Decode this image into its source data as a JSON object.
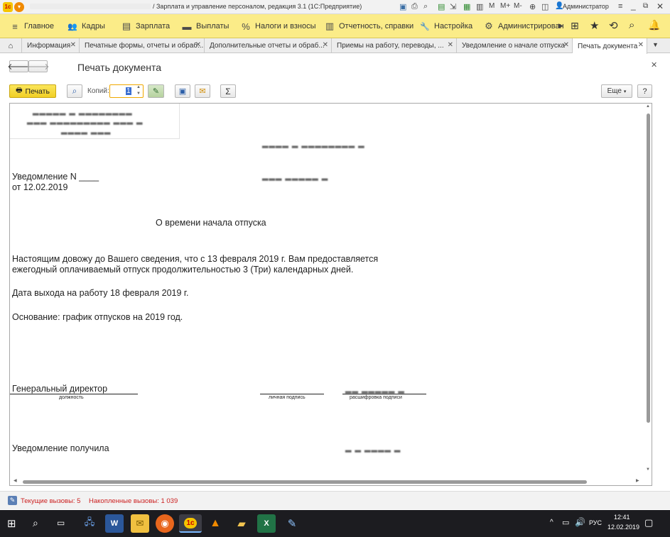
{
  "titlebar": {
    "title": "/ Зарплата и управление персоналом, редакция 3.1  (1С:Предприятие)",
    "user": "Администратор"
  },
  "main_menu": {
    "items": [
      {
        "label": "Главное",
        "icon": "≡"
      },
      {
        "label": "Кадры",
        "icon": "👥"
      },
      {
        "label": "Зарплата",
        "icon": "▤"
      },
      {
        "label": "Выплаты",
        "icon": "▬"
      },
      {
        "label": "Налоги и взносы",
        "icon": "%"
      },
      {
        "label": "Отчетность, справки",
        "icon": "▥"
      },
      {
        "label": "Настройка",
        "icon": "🔧"
      },
      {
        "label": "Администрирован",
        "icon": "⚙"
      }
    ]
  },
  "tabs": [
    {
      "label": "Информация"
    },
    {
      "label": "Печатные формы, отчеты и обраб..."
    },
    {
      "label": "Дополнительные отчеты и обраб..."
    },
    {
      "label": "Приемы на работу, переводы, ..."
    },
    {
      "label": "Уведомление о начале отпуска"
    },
    {
      "label": "Печать документа"
    }
  ],
  "form": {
    "title": "Печать документа",
    "print_button": "Печать",
    "copies_label": "Копий:",
    "copies_value": "1",
    "more_button": "Еще",
    "help_button": "?"
  },
  "document": {
    "notice_number": "Уведомление N ____",
    "date": "от 12.02.2019",
    "subject": "О времени начала отпуска",
    "body_line1": "Настоящим довожу до Вашего сведения, что с 13 февраля 2019 г. Вам предоставляется",
    "body_line2": "ежегодный оплачиваемый отпуск продолжительностью 3 (Три) календарных дней.",
    "return_date": "Дата выхода на работу 18 февраля 2019 г.",
    "basis": "Основание: график отпусков на 2019 год.",
    "signer_position": "Генеральный директор",
    "caption_position": "должность",
    "caption_signature": "личная подпись",
    "caption_decoding": "расшифровка   подписи",
    "received": "Уведомление получила"
  },
  "statusbar": {
    "current_calls": "Текущие вызовы: 5",
    "accumulated_calls": "Накопленные вызовы: 1 039"
  },
  "taskbar": {
    "lang": "РУС",
    "time": "12:41",
    "date": "12.02.2019"
  },
  "colors": {
    "menu_bg": "#fbec88",
    "print_button": "#f5d932",
    "status_red": "#cc2020",
    "taskbar": "#1c1c20"
  }
}
